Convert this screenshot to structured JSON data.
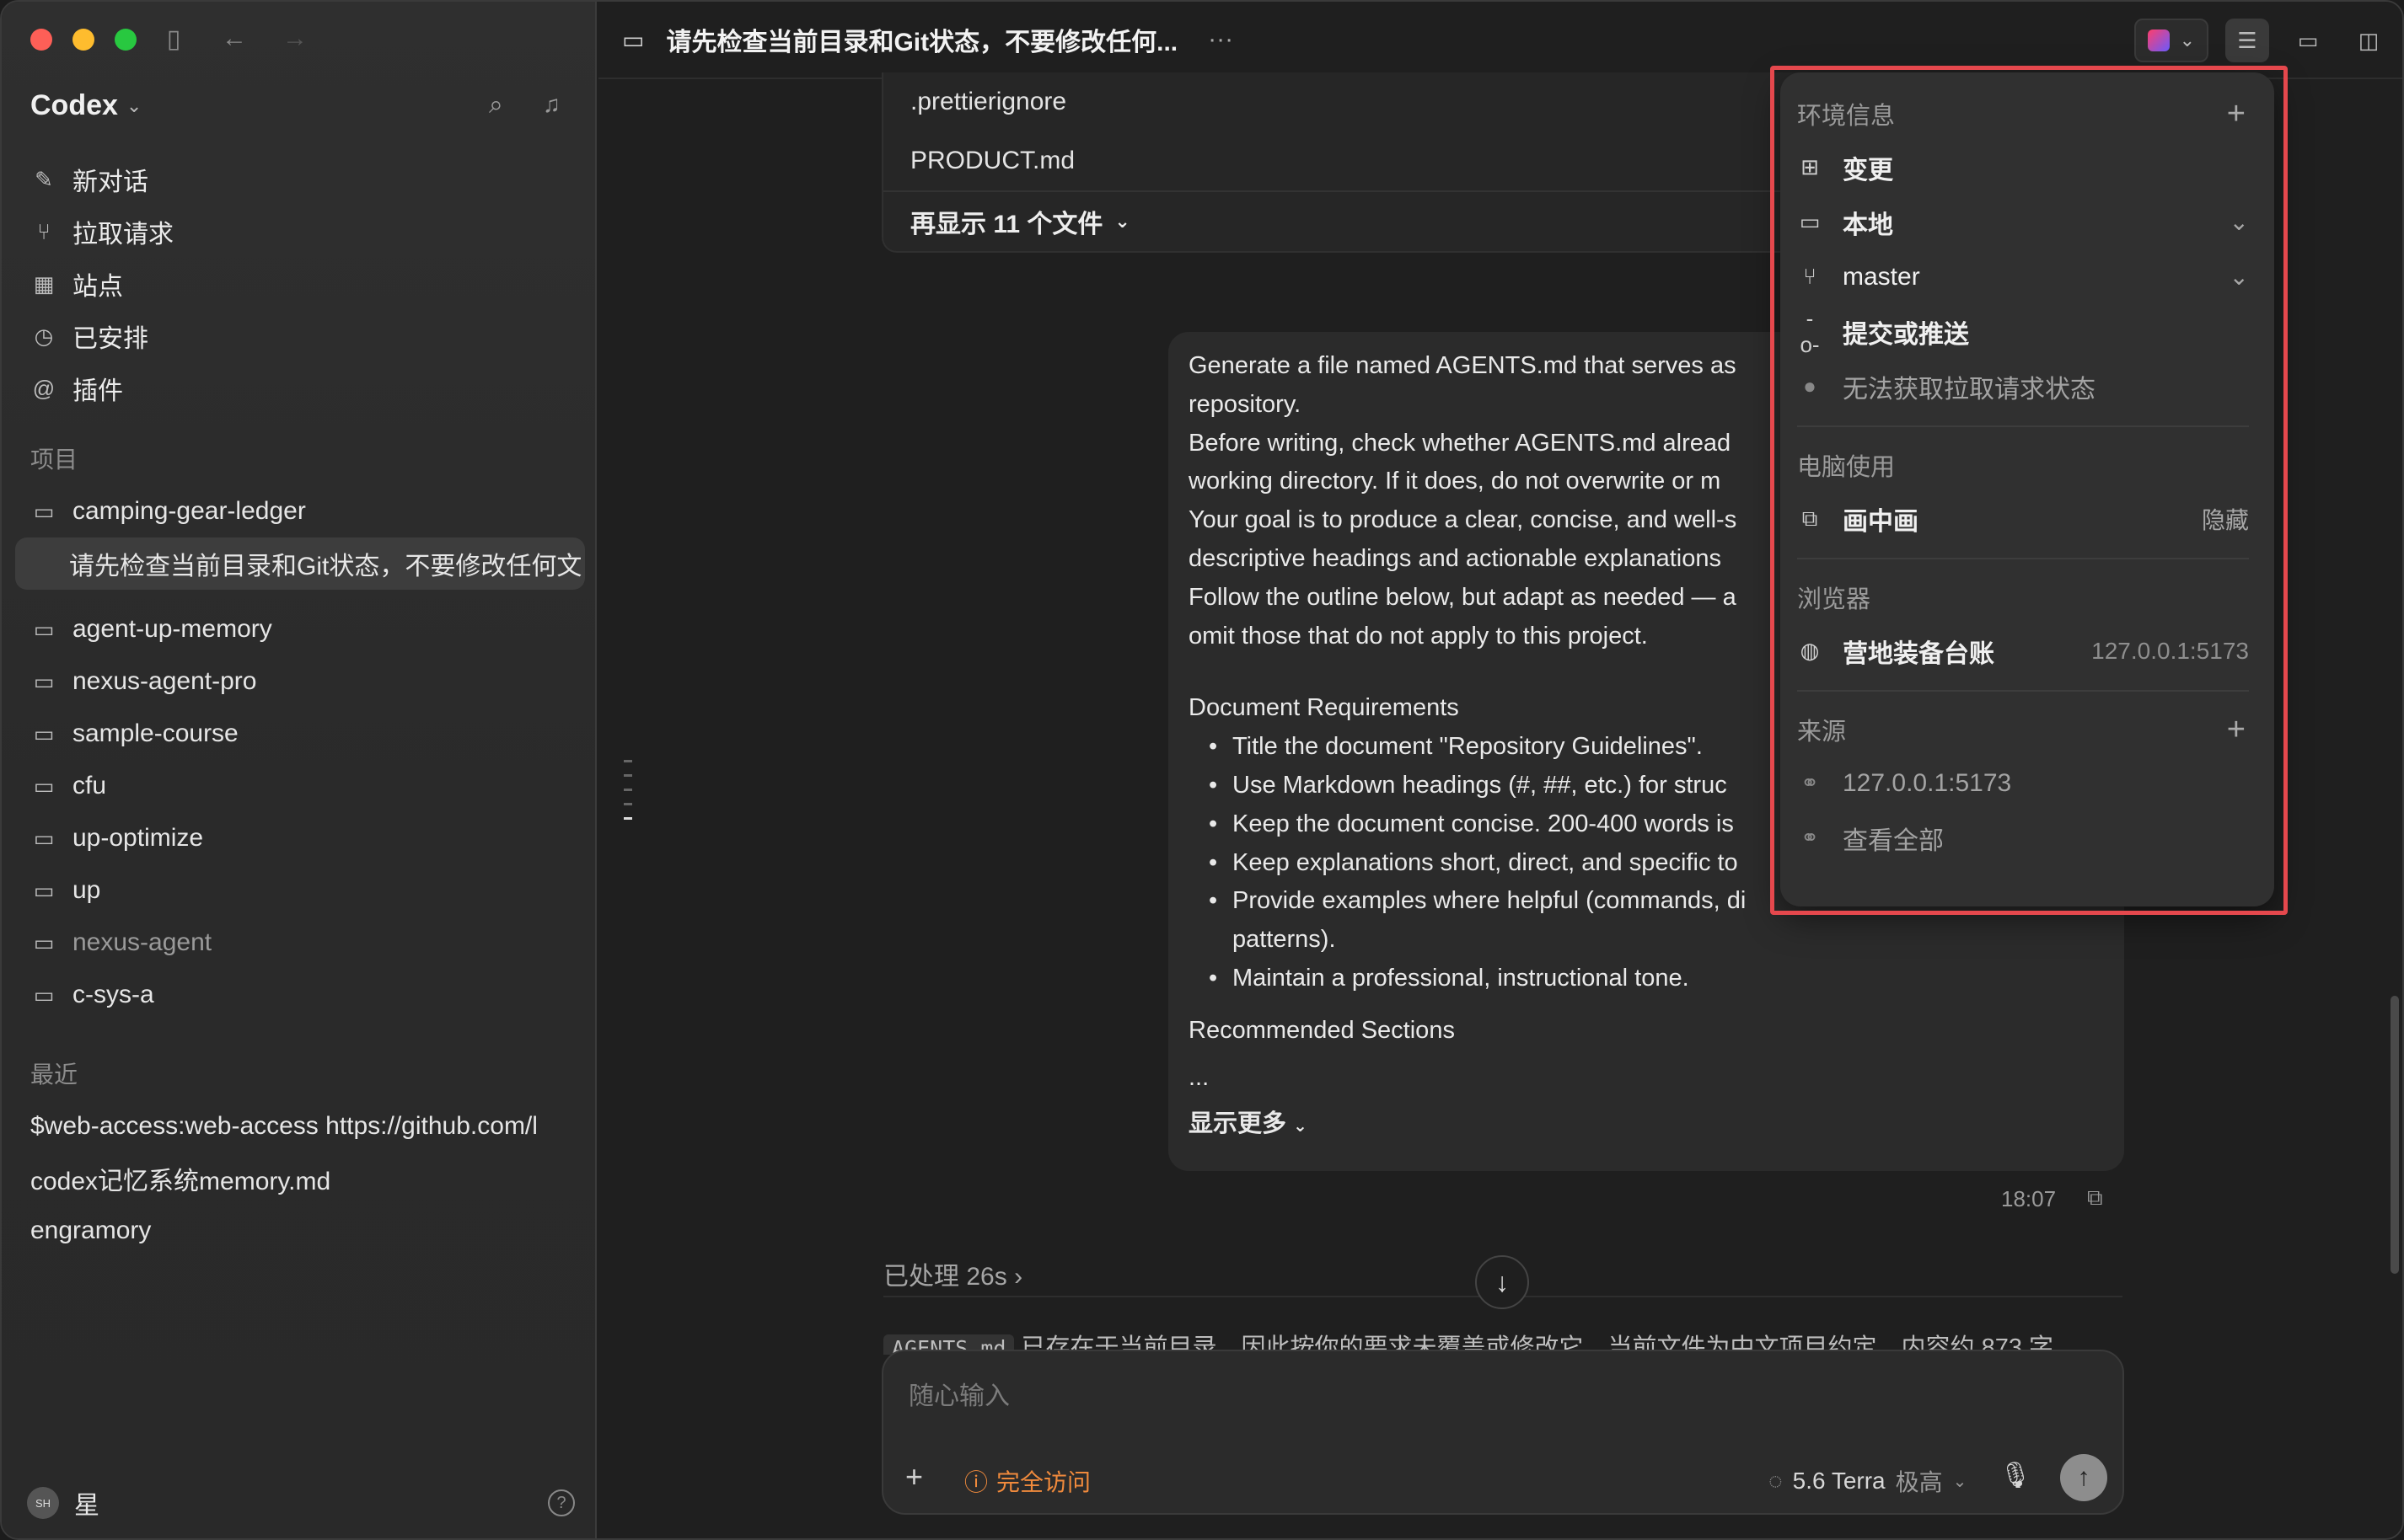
{
  "sidebar": {
    "app_title": "Codex",
    "nav": [
      {
        "label": "新对话",
        "icon": "edit-icon"
      },
      {
        "label": "拉取请求",
        "icon": "pull-request-icon"
      },
      {
        "label": "站点",
        "icon": "sites-icon"
      },
      {
        "label": "已安排",
        "icon": "clock-icon"
      },
      {
        "label": "插件",
        "icon": "plugin-icon"
      }
    ],
    "projects_label": "项目",
    "projects": [
      "camping-gear-ledger",
      "请先检查当前目录和Git状态，不要修改任何文",
      "agent-up-memory",
      "nexus-agent-pro",
      "sample-course",
      "cfu",
      "up-optimize",
      "up",
      "nexus-agent",
      "c-sys-a"
    ],
    "recent_label": "最近",
    "recent": [
      "$web-access:web-access https://github.com/l",
      "codex记忆系统memory.md",
      "engramory"
    ],
    "user_initials": "SH",
    "user_name": "星"
  },
  "topbar": {
    "title": "请先检查当前目录和Git状态，不要修改任何...",
    "more": "···"
  },
  "files": {
    "items": [
      ".prettierignore",
      "PRODUCT.md"
    ],
    "show_more": "再显示 11 个文件"
  },
  "message": {
    "lines": [
      "Generate a file named AGENTS.md that serves as",
      "repository.",
      "Before writing, check whether AGENTS.md alread",
      "working directory. If it does, do not overwrite or m",
      "Your goal is to produce a clear, concise, and well-s",
      "descriptive headings and actionable explanations",
      "Follow the outline below, but adapt as needed — a",
      "omit those that do not apply to this project."
    ],
    "req_heading": "Document Requirements",
    "bullets": [
      "Title the document \"Repository Guidelines\".",
      "Use Markdown headings (#, ##, etc.) for struc",
      "Keep the document concise. 200-400 words is",
      "Keep explanations short, direct, and specific to",
      "Provide examples where helpful (commands, di",
      "patterns).",
      "Maintain a professional, instructional tone."
    ],
    "sections_heading": "Recommended Sections",
    "ellipsis": "...",
    "show_more": "显示更多",
    "time": "18:07"
  },
  "processed": "已处理 26s",
  "reply_peek": {
    "code": "AGENTS.md",
    "text": "已存在于当前目录，因此按你的要求未覆盖或修改它。当前文件为中文项目约定，内容约 873 字"
  },
  "composer": {
    "placeholder": "随心输入",
    "access": "完全访问",
    "model": "5.6 Terra",
    "effort": "极高"
  },
  "popover": {
    "env_label": "环境信息",
    "changes": "变更",
    "local": "本地",
    "branch": "master",
    "commit": "提交或推送",
    "pr_status": "无法获取拉取请求状态",
    "computer_label": "电脑使用",
    "pip": "画中画",
    "pip_hide": "隐藏",
    "browser_label": "浏览器",
    "browser_item": "营地装备台账",
    "browser_url": "127.0.0.1:5173",
    "source_label": "来源",
    "source_url": "127.0.0.1:5173",
    "view_all": "查看全部"
  },
  "colors": {
    "highlight": "#e5484d",
    "access": "#f08a3c"
  }
}
